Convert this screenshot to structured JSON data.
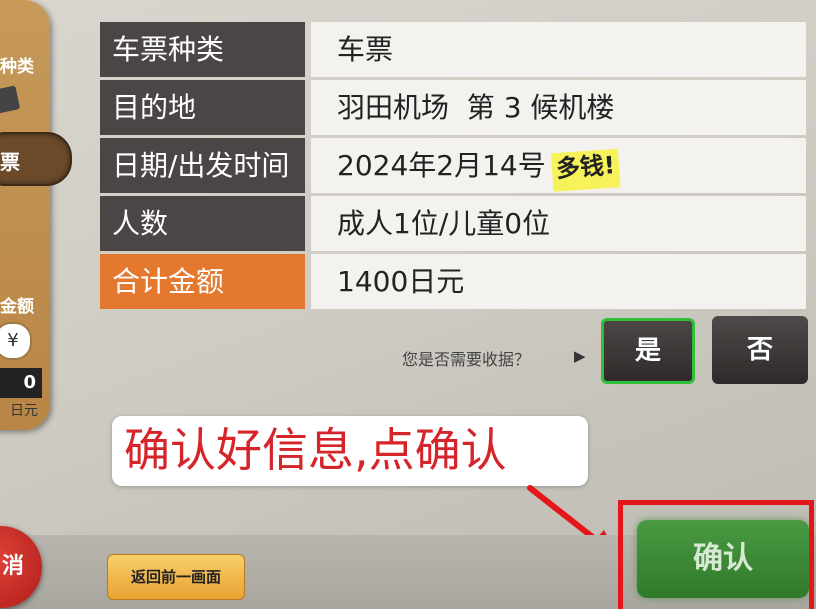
{
  "side_panel": {
    "ticket_type_label": "种类",
    "ticket_label": "票",
    "amount_label": "金额",
    "currency_symbol": "¥",
    "amount_value": "0",
    "amount_unit": "日元",
    "cancel_label": "消"
  },
  "info_table": {
    "rows": [
      {
        "label": "车票种类",
        "value": "车票"
      },
      {
        "label": "目的地",
        "value": "羽田机场  第 3 候机楼"
      },
      {
        "label": "日期/出发时间",
        "value": "2024年2月14号",
        "handwritten_note": "多钱!"
      },
      {
        "label": "人数",
        "value": "成人1位/儿童0位"
      },
      {
        "label": "合计金额",
        "value": "1400日元"
      }
    ]
  },
  "receipt": {
    "question": "您是否需要收据？",
    "yes_label": "是",
    "no_label": "否"
  },
  "annotation": {
    "text": "确认好信息,点确认"
  },
  "bottom": {
    "back_label": "返回前一画面",
    "confirm_label": "确认"
  },
  "colors": {
    "label_bg": "#4b4645",
    "total_label_bg": "#e3782e",
    "confirm_green": "#3a8a34",
    "annotation_red": "#d6252a",
    "highlight_red": "#e5161b"
  }
}
